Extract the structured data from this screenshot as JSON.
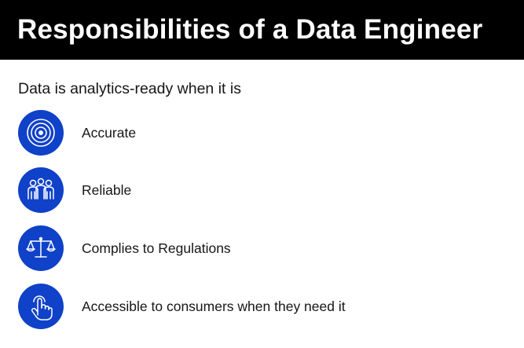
{
  "title": "Responsibilities of a Data Engineer",
  "subtitle": "Data is analytics-ready when it is",
  "items": [
    {
      "label": "Accurate",
      "icon": "target-icon"
    },
    {
      "label": "Reliable",
      "icon": "people-group-icon"
    },
    {
      "label": "Complies to Regulations",
      "icon": "scales-icon"
    },
    {
      "label": "Accessible to consumers when they need it",
      "icon": "touch-hand-icon"
    }
  ],
  "colors": {
    "title_bar": "#000000",
    "title_text": "#ffffff",
    "icon_circle": "#0f41c9",
    "body_text": "#161616"
  }
}
